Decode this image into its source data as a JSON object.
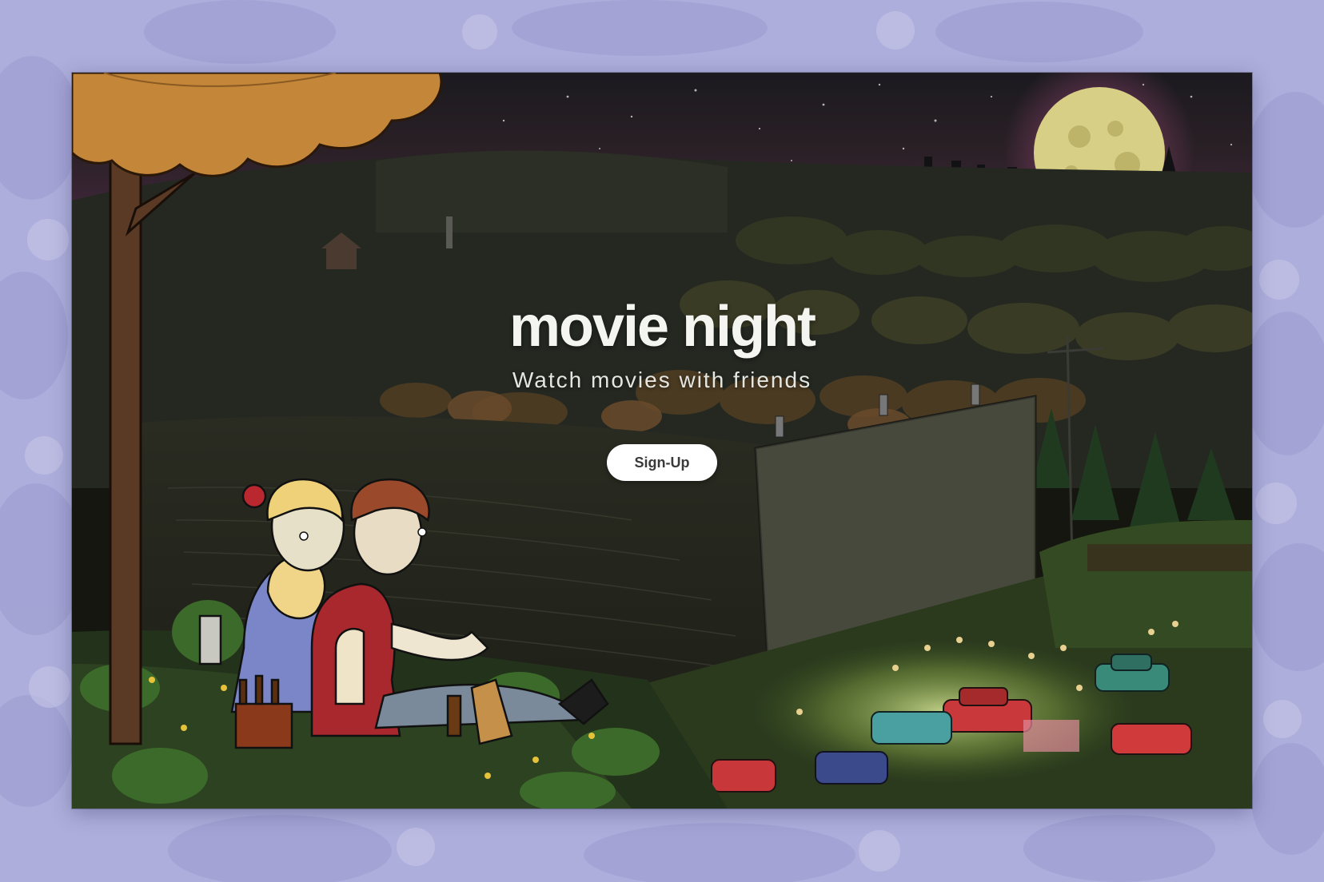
{
  "hero": {
    "title": "movie night",
    "subtitle": "Watch movies with friends",
    "signup_label": "Sign-Up"
  },
  "colors": {
    "backdrop": "#aeaedc",
    "title_text": "#f4f4f0",
    "button_bg": "#ffffff",
    "button_text": "#3a3a3a",
    "night_sky": "#1a1a1e",
    "moon": "#d8cf86",
    "tree_foliage": "#c4873a"
  },
  "illustration": {
    "subject": "drive-in-movie-night-scene",
    "icon": "drive-in-illustration"
  }
}
